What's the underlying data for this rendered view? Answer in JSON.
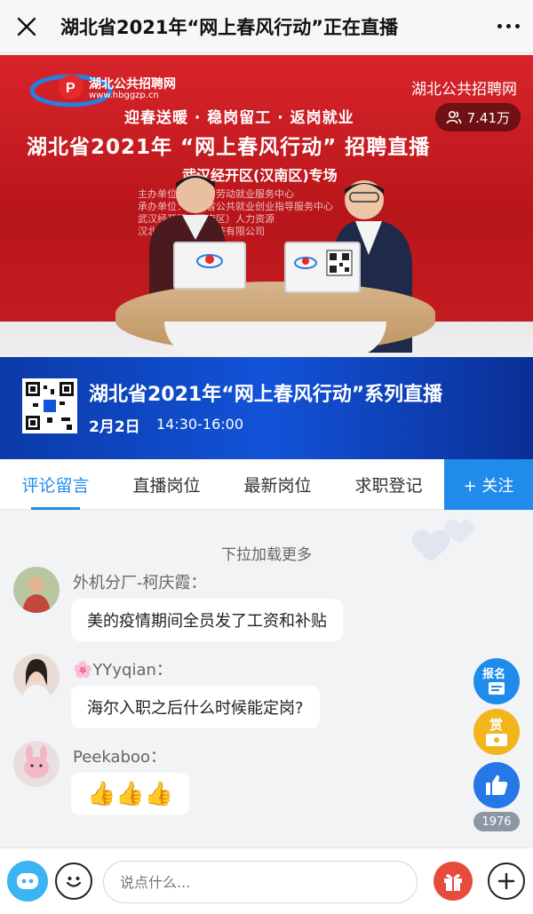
{
  "titlebar": {
    "title": "湖北省2021年“网上春风行动”正在直播",
    "close_icon": "close-icon",
    "more_icon": "more-icon"
  },
  "video": {
    "logo_text": "湖北公共招聘网",
    "logo_url": "www.hbggzp.cn",
    "brand_right": "湖北公共招聘网",
    "slogan": "迎春送暖 · 稳岗留工 · 返岗就业",
    "viewer_count": "7.41万",
    "main_heading": "湖北省2021年 “网上春风行动” 招聘直播",
    "sub_heading": "武汉经开区(汉南区)专场",
    "organizer_lines": [
      "主办单位：湖北省劳动就业服务中心",
      "承办单位：湖北省公共就业创业指导服务中心",
      "武汉经开区（汉南区）人力资源",
      "汉北海天翼信息科技有限公司"
    ],
    "laptop_left_label": "湖北公共招聘网",
    "strip_title": "湖北省2021年“网上春风行动”系列直播",
    "strip_date": "2月2日",
    "strip_time": "14:30-16:00",
    "brand_colors": {
      "red": "#c9141c",
      "blue": "#1253d8"
    }
  },
  "tabs": {
    "items": [
      {
        "label": "评论留言",
        "active": true
      },
      {
        "label": "直播岗位",
        "active": false
      },
      {
        "label": "最新岗位",
        "active": false
      },
      {
        "label": "求职登记",
        "active": false
      }
    ],
    "follow_label": "+ 关注",
    "accent": "#1f8ceb"
  },
  "comments": {
    "pull_hint": "下拉加载更多",
    "items": [
      {
        "name": "外机分厂-柯庆霞：",
        "text": "美的疫情期间全员发了工资和补贴"
      },
      {
        "name": "🌸YYyqian：",
        "text": "海尔入职之后什么时候能定岗?"
      },
      {
        "name": "Peekaboo：",
        "text": "👍👍👍"
      }
    ]
  },
  "side": {
    "signup_label": "报名",
    "reward_label": "赏",
    "like_count": "1976"
  },
  "bottombar": {
    "input_placeholder": "说点什么..."
  }
}
